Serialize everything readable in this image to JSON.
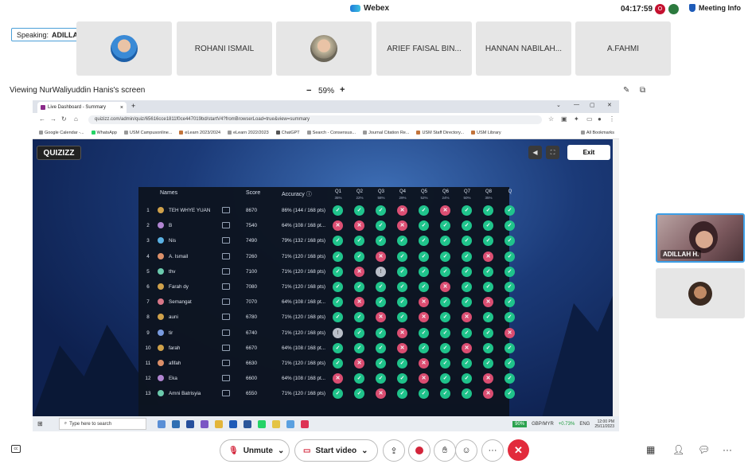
{
  "app": {
    "title": "Webex",
    "clock": "04:17:59",
    "meeting_info": "Meeting Info"
  },
  "speaking": {
    "label": "Speaking:",
    "name": "ADILLAH H."
  },
  "participants": [
    "ROHANI ISMAIL",
    "ARIEF FAISAL BIN...",
    "HANNAN NABILAH...",
    "A.FAHMI"
  ],
  "share": {
    "viewing": "Viewing NurWaliyuddin Hanis's screen",
    "zoom": "59%",
    "zoom_minus": "−",
    "zoom_plus": "+"
  },
  "browser": {
    "tab_title": "Live Dashboard - Summary",
    "url": "quizizz.com/admin/quiz/65616cce1811f0ce447019bd/startV4?fromBrowserLoad=true&view=summary",
    "bookmarks": [
      "Google Calendar -...",
      "WhatsApp",
      "USM Campusonline...",
      "eLearn 2023/2024",
      "eLearn 2022/2023",
      "ChatGPT",
      "Search - Consensus...",
      "Journal Citation Re...",
      "USM Staff Directory...",
      "USM Library"
    ],
    "all_bookmarks": "All Bookmarks"
  },
  "quiz": {
    "brand": "QUIZIZZ",
    "exit_label": "Exit",
    "headers": {
      "names": "Names",
      "score": "Score",
      "accuracy": "Accuracy ⓘ"
    },
    "questions": [
      {
        "q": "Q1",
        "p": "35%"
      },
      {
        "q": "Q2",
        "p": "22%"
      },
      {
        "q": "Q3",
        "p": "58%"
      },
      {
        "q": "Q4",
        "p": "29%"
      },
      {
        "q": "Q5",
        "p": "52%"
      },
      {
        "q": "Q6",
        "p": "24%"
      },
      {
        "q": "Q7",
        "p": "50%"
      },
      {
        "q": "Q8",
        "p": "35%"
      },
      {
        "q": "Q",
        "p": ""
      }
    ],
    "rows": [
      {
        "rank": "1",
        "name": "TEH WHYE YUAN",
        "score": "8670",
        "acc": "86% (144 / 168 pts)",
        "r": [
          "ok",
          "ok",
          "ok",
          "bad",
          "ok",
          "bad",
          "ok",
          "ok",
          "ok"
        ]
      },
      {
        "rank": "2",
        "name": "B",
        "score": "7540",
        "acc": "64% (108 / 168 pt...",
        "r": [
          "bad",
          "bad",
          "ok",
          "bad",
          "ok",
          "ok",
          "ok",
          "ok",
          "ok"
        ]
      },
      {
        "rank": "3",
        "name": "Nis",
        "score": "7490",
        "acc": "79% (132 / 168 pts)",
        "r": [
          "ok",
          "ok",
          "ok",
          "ok",
          "ok",
          "ok",
          "ok",
          "ok",
          "ok"
        ]
      },
      {
        "rank": "4",
        "name": "A. Ismail",
        "score": "7260",
        "acc": "71% (120 / 168 pts)",
        "r": [
          "ok",
          "ok",
          "bad",
          "ok",
          "ok",
          "ok",
          "ok",
          "bad",
          "ok"
        ]
      },
      {
        "rank": "5",
        "name": "thv",
        "score": "7100",
        "acc": "71% (120 / 168 pts)",
        "r": [
          "ok",
          "bad",
          "nu",
          "ok",
          "ok",
          "ok",
          "ok",
          "ok",
          "ok"
        ]
      },
      {
        "rank": "6",
        "name": "Farah dy",
        "score": "7080",
        "acc": "71% (120 / 168 pts)",
        "r": [
          "ok",
          "ok",
          "ok",
          "ok",
          "ok",
          "bad",
          "ok",
          "ok",
          "ok"
        ]
      },
      {
        "rank": "7",
        "name": "Semangat",
        "score": "7070",
        "acc": "64% (108 / 168 pt...",
        "r": [
          "ok",
          "bad",
          "ok",
          "ok",
          "bad",
          "ok",
          "ok",
          "bad",
          "ok"
        ]
      },
      {
        "rank": "8",
        "name": "auni",
        "score": "6780",
        "acc": "71% (120 / 168 pts)",
        "r": [
          "ok",
          "ok",
          "bad",
          "ok",
          "bad",
          "ok",
          "bad",
          "ok",
          "ok"
        ]
      },
      {
        "rank": "9",
        "name": "tir",
        "score": "6740",
        "acc": "71% (120 / 168 pts)",
        "r": [
          "nu",
          "ok",
          "ok",
          "bad",
          "ok",
          "ok",
          "ok",
          "ok",
          "bad"
        ]
      },
      {
        "rank": "10",
        "name": "farah",
        "score": "6670",
        "acc": "64% (108 / 168 pt...",
        "r": [
          "ok",
          "ok",
          "ok",
          "bad",
          "ok",
          "ok",
          "bad",
          "ok",
          "ok"
        ]
      },
      {
        "rank": "11",
        "name": "afifah",
        "score": "6630",
        "acc": "71% (120 / 168 pts)",
        "r": [
          "ok",
          "bad",
          "ok",
          "ok",
          "bad",
          "ok",
          "ok",
          "ok",
          "ok"
        ]
      },
      {
        "rank": "12",
        "name": "Eka",
        "score": "6600",
        "acc": "64% (108 / 168 pt...",
        "r": [
          "bad",
          "ok",
          "ok",
          "ok",
          "bad",
          "ok",
          "ok",
          "bad",
          "ok"
        ]
      },
      {
        "rank": "13",
        "name": "Amni Batrisyia",
        "score": "6550",
        "acc": "71% (120 / 168 pts)",
        "r": [
          "ok",
          "ok",
          "bad",
          "ok",
          "ok",
          "ok",
          "ok",
          "bad",
          "ok"
        ]
      }
    ]
  },
  "taskbar": {
    "search": "Type here to search",
    "battery": "90%",
    "currency": "GBP/MYR",
    "currency_change": "+0.73%",
    "lang": "ENG",
    "time": "12:00 PM",
    "date": "25/11/2023"
  },
  "self_view": {
    "name": "ADILLAH H."
  },
  "controls": {
    "mute": "Unmute",
    "video": "Start video"
  }
}
